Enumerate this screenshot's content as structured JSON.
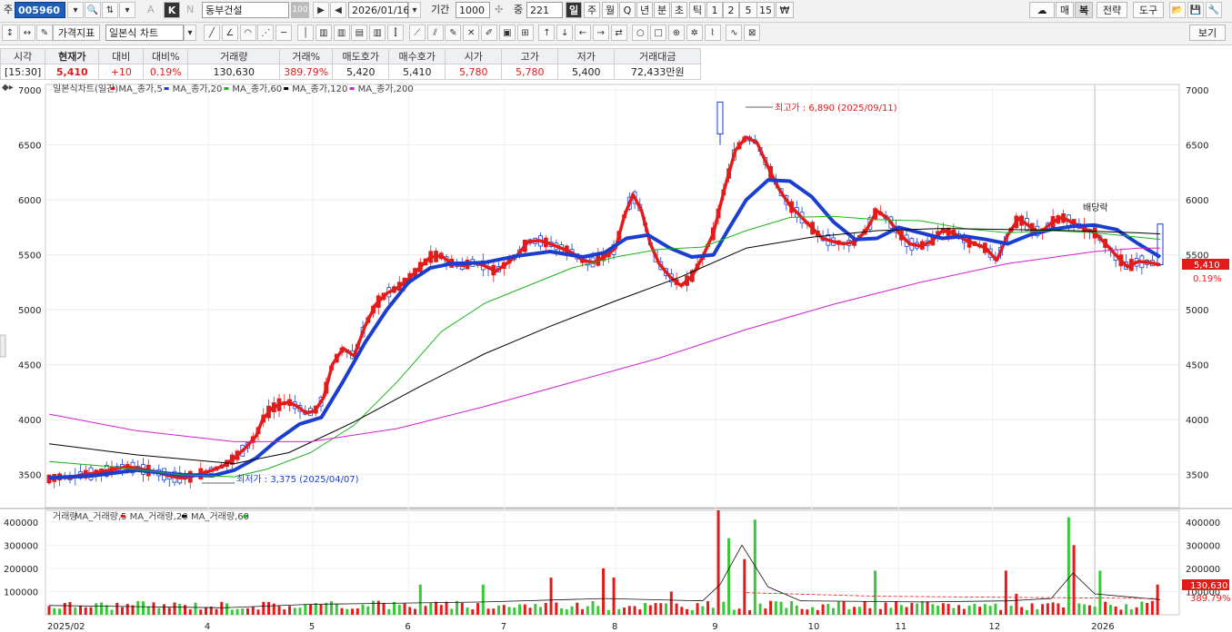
{
  "toolbar1": {
    "market_label": "주",
    "code": "005960",
    "cat_k": "K",
    "cat_n": "N",
    "a_label": "A",
    "stock_name": "동부건설",
    "stock_num": "100",
    "date": "2026/01/16",
    "period_label": "기간",
    "period_value": "1000",
    "count_label": "중",
    "count_value": "221",
    "intervals": [
      "일",
      "주",
      "월",
      "Q",
      "년",
      "분",
      "초",
      "틱",
      "1",
      "2",
      "5",
      "15",
      "₩"
    ],
    "right_buttons": [
      "매",
      "복",
      "전략",
      "도구"
    ]
  },
  "toolbar2": {
    "tab_price": "가격지표",
    "chart_type": "일본식 차트",
    "view_button": "보기"
  },
  "quote": {
    "headers": [
      "시각",
      "현재가",
      "대비",
      "대비%",
      "거래량",
      "거래%",
      "매도호가",
      "매수호가",
      "시가",
      "고가",
      "저가",
      "거래대금"
    ],
    "time": "[15:30]",
    "price": "5,410",
    "change": "+10",
    "change_pct": "0.19%",
    "volume": "130,630",
    "volume_pct": "389.79%",
    "ask": "5,420",
    "bid": "5,410",
    "open": "5,780",
    "high": "5,780",
    "low": "5,400",
    "amount": "72,433만원"
  },
  "colors": {
    "up": "#e31b1b",
    "down": "#1a3fd0",
    "ma5": "#e31b1b",
    "ma20": "#1a3fd0",
    "ma60": "#1db51d",
    "ma120": "#000000",
    "ma200": "#d21fd2",
    "vol_up": "#e31b1b",
    "vol_down": "#39c839"
  },
  "chart_data": {
    "type": "line",
    "legend": [
      "일본식차트(일간)",
      "MA_종가,5",
      "MA_종가,20",
      "MA_종가,60",
      "MA_종가,120",
      "MA_종가,200"
    ],
    "price_ylim": [
      3200,
      7050
    ],
    "price_ticks": [
      3500,
      4000,
      4500,
      5000,
      5500,
      6000,
      6500,
      7000
    ],
    "x_labels": [
      "2025/02",
      "4",
      "5",
      "6",
      "7",
      "8",
      "9",
      "10",
      "11",
      "12",
      "2026"
    ],
    "annotations": {
      "high": "최고가 : 6,890 (2025/09/11)",
      "low": "최저가 : 3,375 (2025/04/07)",
      "dividend": "배당락"
    },
    "last_price_label": "5,410",
    "last_pct_label": "0.19%",
    "series": [
      {
        "name": "MA_종가,5",
        "values": [
          [
            0,
            3460
          ],
          [
            5,
            3480
          ],
          [
            10,
            3470
          ],
          [
            15,
            3500
          ],
          [
            20,
            3510
          ],
          [
            25,
            3530
          ],
          [
            30,
            3550
          ],
          [
            35,
            3570
          ],
          [
            40,
            3560
          ],
          [
            45,
            3540
          ],
          [
            50,
            3520
          ],
          [
            55,
            3490
          ],
          [
            60,
            3470
          ],
          [
            65,
            3480
          ],
          [
            70,
            3510
          ],
          [
            75,
            3540
          ],
          [
            80,
            3580
          ],
          [
            85,
            3650
          ],
          [
            90,
            3740
          ],
          [
            95,
            3850
          ],
          [
            98,
            4000
          ],
          [
            102,
            4100
          ],
          [
            106,
            4140
          ],
          [
            110,
            4160
          ],
          [
            114,
            4120
          ],
          [
            118,
            4060
          ],
          [
            122,
            4080
          ],
          [
            126,
            4200
          ],
          [
            130,
            4500
          ],
          [
            135,
            4650
          ],
          [
            140,
            4580
          ],
          [
            145,
            4850
          ],
          [
            150,
            5050
          ],
          [
            155,
            5150
          ],
          [
            160,
            5200
          ],
          [
            165,
            5280
          ],
          [
            170,
            5380
          ],
          [
            175,
            5480
          ],
          [
            180,
            5490
          ],
          [
            185,
            5420
          ],
          [
            190,
            5400
          ],
          [
            195,
            5430
          ],
          [
            200,
            5400
          ],
          [
            205,
            5350
          ],
          [
            210,
            5420
          ],
          [
            215,
            5500
          ],
          [
            220,
            5620
          ],
          [
            225,
            5630
          ],
          [
            230,
            5600
          ],
          [
            235,
            5560
          ],
          [
            240,
            5520
          ],
          [
            245,
            5450
          ],
          [
            250,
            5430
          ],
          [
            255,
            5480
          ],
          [
            260,
            5560
          ],
          [
            264,
            5850
          ],
          [
            268,
            6050
          ],
          [
            272,
            5900
          ],
          [
            276,
            5600
          ],
          [
            280,
            5420
          ],
          [
            285,
            5300
          ],
          [
            290,
            5220
          ],
          [
            295,
            5300
          ],
          [
            300,
            5480
          ],
          [
            305,
            5700
          ],
          [
            310,
            6100
          ],
          [
            315,
            6450
          ],
          [
            320,
            6570
          ],
          [
            325,
            6520
          ],
          [
            330,
            6300
          ],
          [
            335,
            6100
          ],
          [
            340,
            5950
          ],
          [
            345,
            5850
          ],
          [
            350,
            5750
          ],
          [
            355,
            5650
          ],
          [
            360,
            5620
          ],
          [
            365,
            5600
          ],
          [
            370,
            5620
          ],
          [
            375,
            5720
          ],
          [
            380,
            5900
          ],
          [
            385,
            5830
          ],
          [
            390,
            5700
          ],
          [
            395,
            5600
          ],
          [
            400,
            5580
          ],
          [
            405,
            5620
          ],
          [
            410,
            5720
          ],
          [
            415,
            5700
          ],
          [
            420,
            5640
          ],
          [
            425,
            5600
          ],
          [
            430,
            5560
          ],
          [
            435,
            5450
          ],
          [
            440,
            5680
          ],
          [
            445,
            5830
          ],
          [
            450,
            5760
          ],
          [
            455,
            5700
          ],
          [
            460,
            5790
          ],
          [
            465,
            5840
          ],
          [
            470,
            5790
          ],
          [
            475,
            5740
          ],
          [
            480,
            5700
          ],
          [
            485,
            5600
          ],
          [
            490,
            5490
          ],
          [
            495,
            5390
          ],
          [
            500,
            5440
          ],
          [
            505,
            5430
          ],
          [
            510,
            5410
          ]
        ]
      },
      {
        "name": "MA_종가,20",
        "values": [
          [
            0,
            3470
          ],
          [
            20,
            3490
          ],
          [
            40,
            3540
          ],
          [
            60,
            3500
          ],
          [
            75,
            3490
          ],
          [
            85,
            3540
          ],
          [
            95,
            3650
          ],
          [
            105,
            3820
          ],
          [
            115,
            3960
          ],
          [
            125,
            4020
          ],
          [
            135,
            4350
          ],
          [
            145,
            4700
          ],
          [
            155,
            5000
          ],
          [
            165,
            5250
          ],
          [
            175,
            5380
          ],
          [
            185,
            5420
          ],
          [
            200,
            5430
          ],
          [
            215,
            5490
          ],
          [
            230,
            5530
          ],
          [
            245,
            5480
          ],
          [
            255,
            5520
          ],
          [
            265,
            5650
          ],
          [
            275,
            5680
          ],
          [
            285,
            5560
          ],
          [
            295,
            5480
          ],
          [
            305,
            5500
          ],
          [
            312,
            5740
          ],
          [
            320,
            6000
          ],
          [
            330,
            6180
          ],
          [
            340,
            6170
          ],
          [
            350,
            6030
          ],
          [
            360,
            5800
          ],
          [
            370,
            5640
          ],
          [
            380,
            5650
          ],
          [
            390,
            5750
          ],
          [
            400,
            5700
          ],
          [
            410,
            5650
          ],
          [
            420,
            5670
          ],
          [
            430,
            5640
          ],
          [
            440,
            5600
          ],
          [
            450,
            5680
          ],
          [
            460,
            5730
          ],
          [
            470,
            5760
          ],
          [
            480,
            5770
          ],
          [
            490,
            5730
          ],
          [
            500,
            5600
          ],
          [
            510,
            5480
          ]
        ]
      },
      {
        "name": "MA_종가,60",
        "values": [
          [
            0,
            3620
          ],
          [
            30,
            3570
          ],
          [
            60,
            3500
          ],
          [
            85,
            3480
          ],
          [
            100,
            3550
          ],
          [
            120,
            3700
          ],
          [
            140,
            3950
          ],
          [
            160,
            4350
          ],
          [
            180,
            4800
          ],
          [
            200,
            5060
          ],
          [
            220,
            5220
          ],
          [
            240,
            5380
          ],
          [
            260,
            5480
          ],
          [
            280,
            5550
          ],
          [
            300,
            5570
          ],
          [
            320,
            5720
          ],
          [
            340,
            5840
          ],
          [
            360,
            5850
          ],
          [
            380,
            5820
          ],
          [
            400,
            5810
          ],
          [
            420,
            5740
          ],
          [
            440,
            5700
          ],
          [
            460,
            5720
          ],
          [
            480,
            5700
          ],
          [
            500,
            5660
          ],
          [
            510,
            5640
          ]
        ]
      },
      {
        "name": "MA_종가,120",
        "values": [
          [
            0,
            3780
          ],
          [
            40,
            3680
          ],
          [
            85,
            3600
          ],
          [
            110,
            3700
          ],
          [
            140,
            3980
          ],
          [
            170,
            4300
          ],
          [
            200,
            4600
          ],
          [
            230,
            4850
          ],
          [
            260,
            5080
          ],
          [
            290,
            5300
          ],
          [
            320,
            5560
          ],
          [
            350,
            5660
          ],
          [
            380,
            5720
          ],
          [
            410,
            5740
          ],
          [
            440,
            5730
          ],
          [
            470,
            5720
          ],
          [
            500,
            5700
          ],
          [
            510,
            5690
          ]
        ]
      },
      {
        "name": "MA_종가,200",
        "values": [
          [
            0,
            4050
          ],
          [
            40,
            3900
          ],
          [
            85,
            3800
          ],
          [
            120,
            3800
          ],
          [
            160,
            3920
          ],
          [
            200,
            4120
          ],
          [
            240,
            4340
          ],
          [
            280,
            4560
          ],
          [
            320,
            4820
          ],
          [
            360,
            5050
          ],
          [
            400,
            5250
          ],
          [
            440,
            5420
          ],
          [
            480,
            5530
          ],
          [
            500,
            5560
          ],
          [
            510,
            5560
          ]
        ]
      }
    ],
    "volume": {
      "legend": [
        "거래량",
        "MA_거래량,5",
        "MA_거래량,20",
        "MA_거래량,60"
      ],
      "ylim": [
        0,
        450000
      ],
      "ticks": [
        100000,
        200000,
        300000,
        400000
      ],
      "tick_labels": [
        "100000",
        "200000",
        "300000",
        "400000"
      ],
      "last_volume_label": "130,630",
      "last_volume_pct_label": "389.79%",
      "spikes": [
        [
          150,
          60000
        ],
        [
          170,
          130000
        ],
        [
          200,
          130000
        ],
        [
          230,
          160000
        ],
        [
          255,
          200000
        ],
        [
          260,
          160000
        ],
        [
          285,
          100000
        ],
        [
          308,
          450000
        ],
        [
          313,
          330000
        ],
        [
          320,
          240000
        ],
        [
          325,
          410000
        ],
        [
          380,
          190000
        ],
        [
          440,
          190000
        ],
        [
          444,
          90000
        ],
        [
          468,
          420000
        ],
        [
          470,
          300000
        ],
        [
          482,
          190000
        ],
        [
          510,
          130000
        ]
      ]
    }
  }
}
